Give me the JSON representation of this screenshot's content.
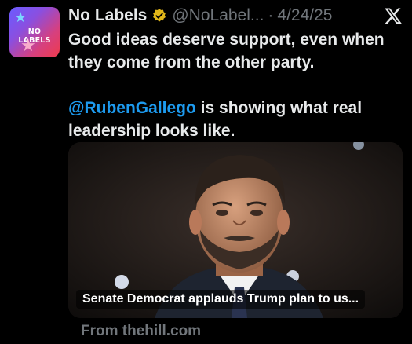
{
  "account": {
    "avatar_text": "NO LABELS",
    "display_name": "No Labels",
    "handle": "@NoLabel...",
    "separator": "·",
    "date": "4/24/25",
    "verified_badge_icon": "gold-verified-badge-icon"
  },
  "post": {
    "paragraph1": "Good ideas deserve support, even when they come from the other party.",
    "mention": "@RubenGallego",
    "paragraph2_rest": " is showing what real leadership looks like."
  },
  "link_card": {
    "title": "Senate Democrat applauds Trump plan to us...",
    "source": "From thehill.com"
  },
  "icons": {
    "close": "x-logo-icon"
  },
  "colors": {
    "background": "#000000",
    "text": "#e7e9ea",
    "secondary": "#71767b",
    "link": "#1d9bf0",
    "badge": "#e2b719"
  }
}
